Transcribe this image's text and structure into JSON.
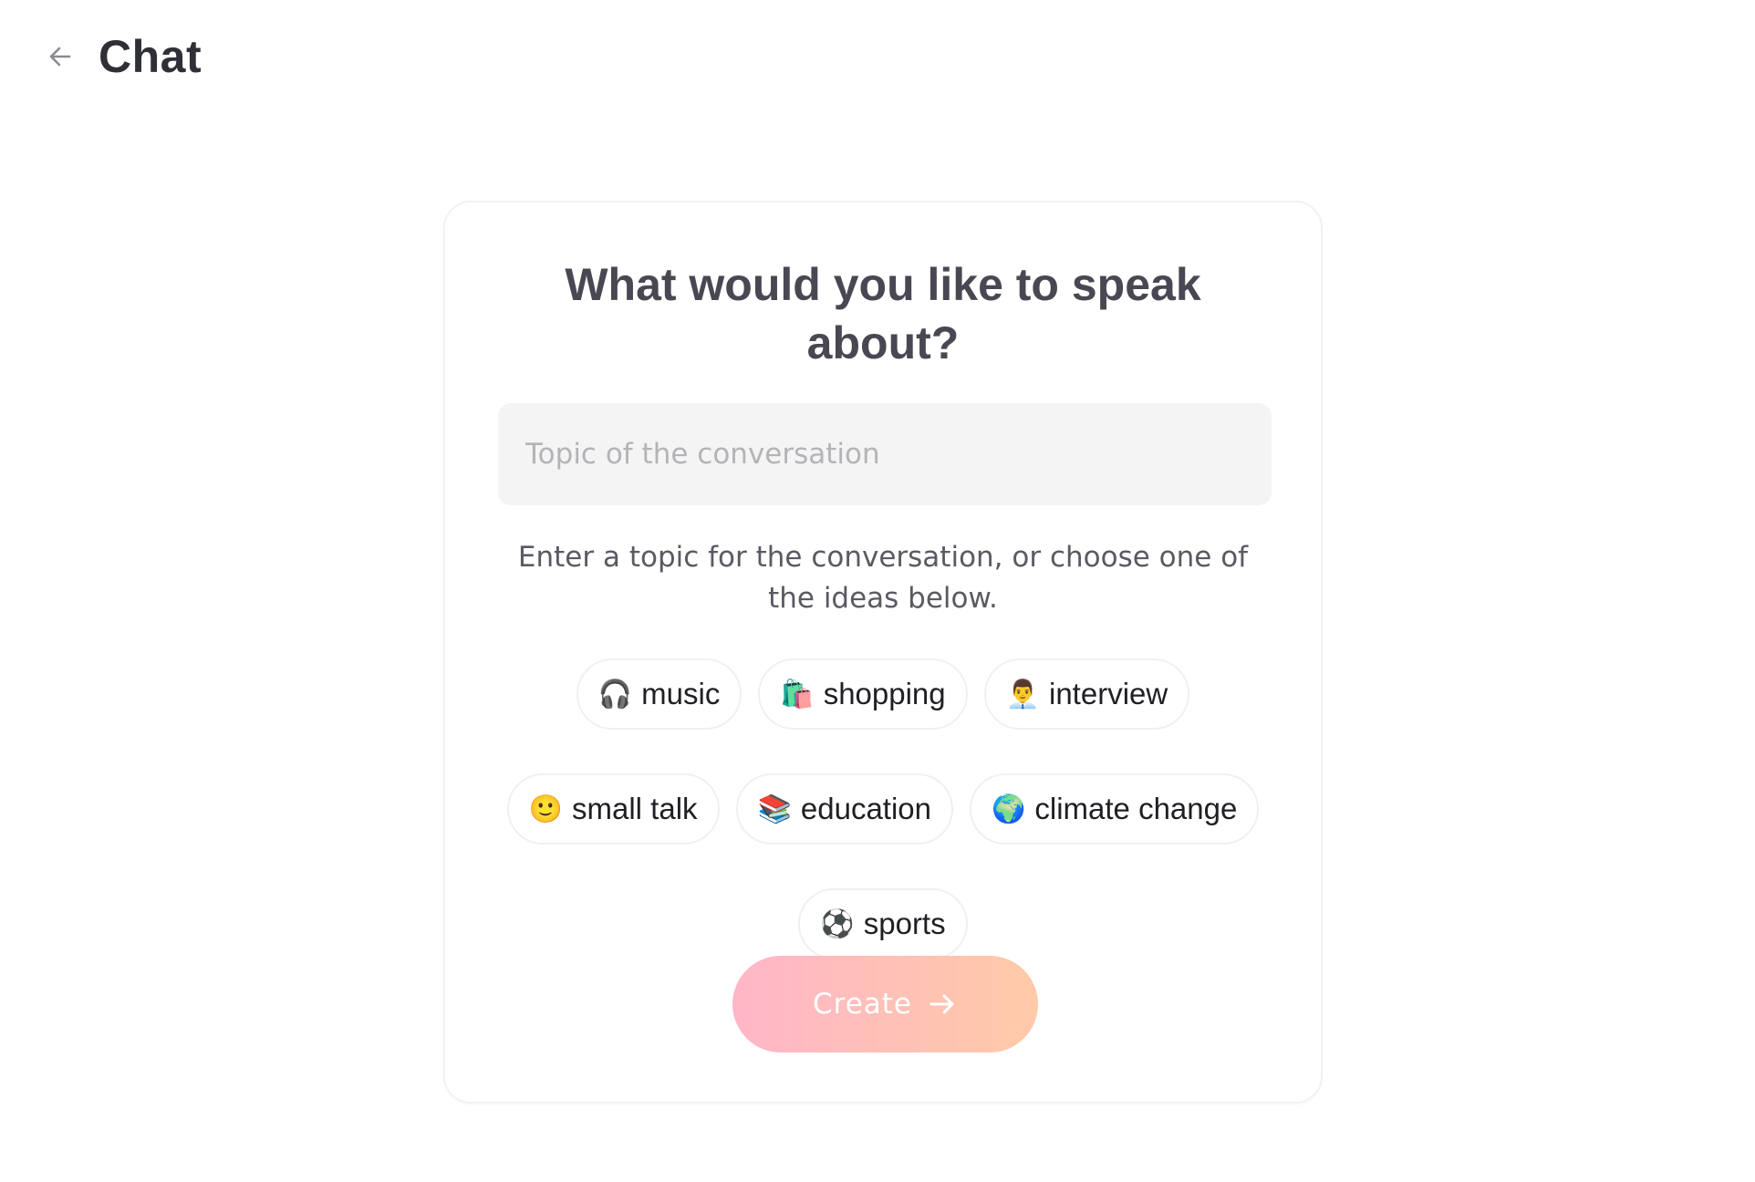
{
  "header": {
    "title": "Chat",
    "back_icon": "arrow-left-icon"
  },
  "card": {
    "heading": "What would you like to speak about?",
    "input": {
      "placeholder": "Topic of the conversation",
      "value": ""
    },
    "hint": "Enter a topic for the conversation, or choose one of the ideas below.",
    "chips": [
      {
        "emoji": "🎧",
        "label": "music"
      },
      {
        "emoji": "🛍️",
        "label": "shopping"
      },
      {
        "emoji": "👨‍💼",
        "label": "interview"
      },
      {
        "emoji": "🙂",
        "label": "small talk"
      },
      {
        "emoji": "📚",
        "label": "education"
      },
      {
        "emoji": "🌍",
        "label": "climate change"
      },
      {
        "emoji": "⚽",
        "label": "sports"
      }
    ],
    "create_button": {
      "label": "Create",
      "icon": "arrow-right-icon"
    }
  },
  "colors": {
    "title": "#2f2f38",
    "button_gradient_start": "#ffb6c8",
    "button_gradient_end": "#ffcaa8",
    "input_bg": "#f4f4f4"
  }
}
